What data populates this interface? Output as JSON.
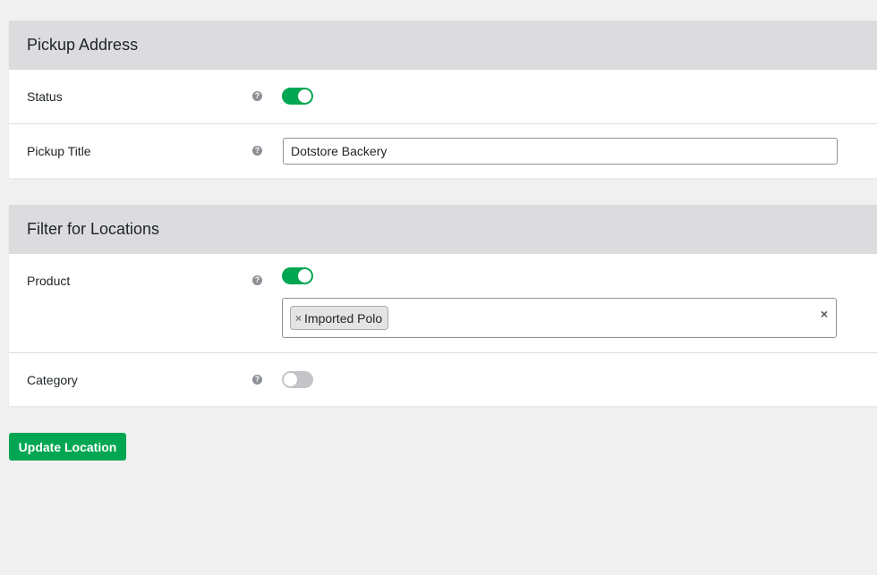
{
  "pickup_address": {
    "title": "Pickup Address",
    "status": {
      "label": "Status",
      "help": "?",
      "enabled": true
    },
    "pickup_title": {
      "label": "Pickup Title",
      "help": "?",
      "value": "Dotstore Backery"
    }
  },
  "filter_locations": {
    "title": "Filter for Locations",
    "product": {
      "label": "Product",
      "help": "?",
      "enabled": true,
      "selected": [
        {
          "remove": "×",
          "label": "Imported Polo"
        }
      ],
      "clear_all": "×"
    },
    "category": {
      "label": "Category",
      "help": "?",
      "enabled": false
    }
  },
  "actions": {
    "update_label": "Update Location"
  },
  "colors": {
    "accent": "#00a651",
    "header_bg": "#dcdcde",
    "page_bg": "#f0f0f1"
  },
  "icons": {
    "help": "help-circle-icon",
    "remove": "close-icon"
  }
}
